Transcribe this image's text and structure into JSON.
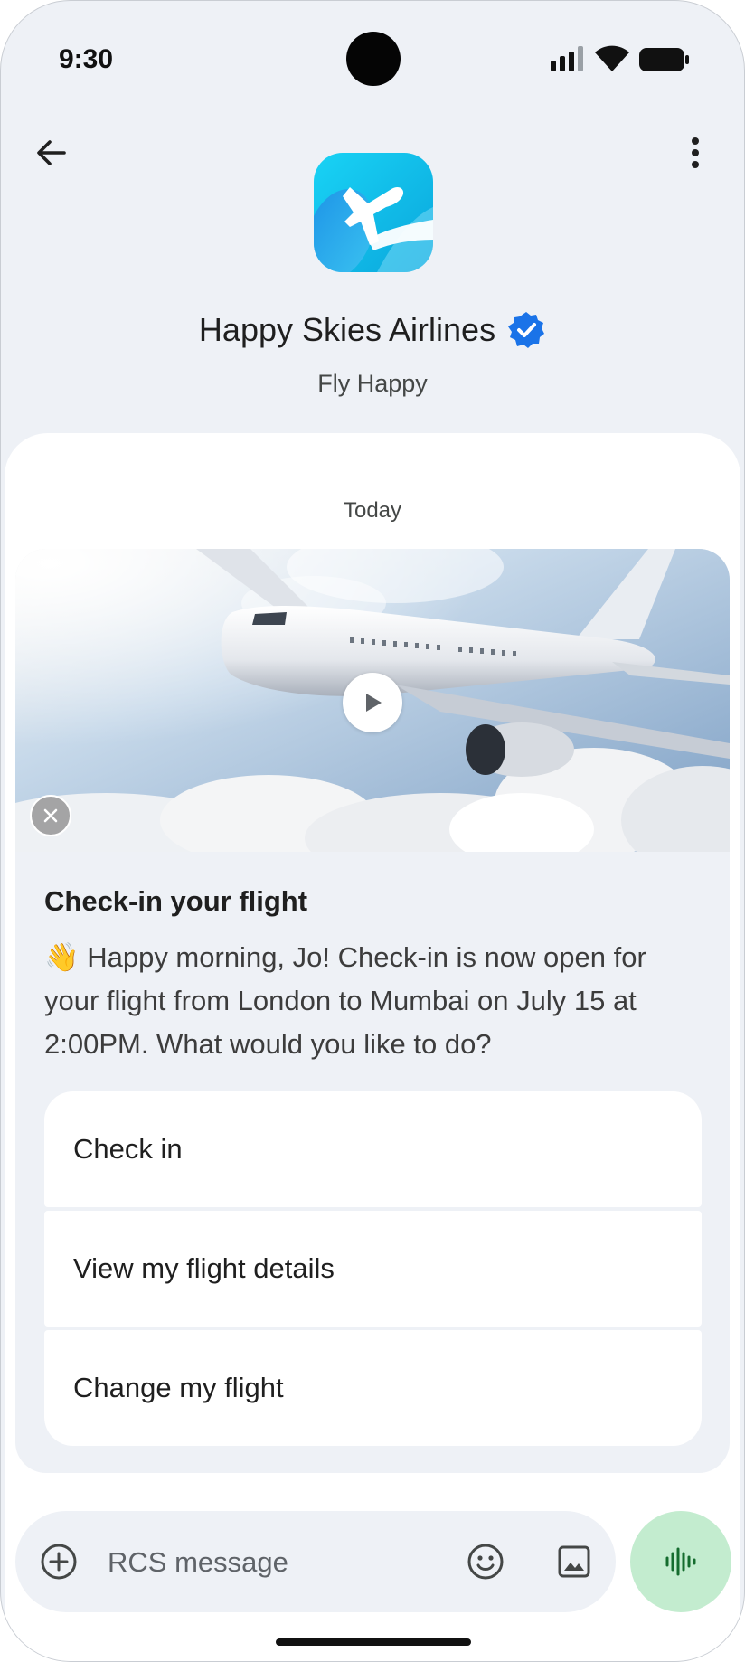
{
  "status_bar": {
    "time": "9:30",
    "icons": [
      "signal-icon",
      "wifi-icon",
      "battery-icon"
    ]
  },
  "header": {
    "back_icon": "arrow-left-icon",
    "more_icon": "more-vertical-icon",
    "logo_icon": "airplane-logo-icon",
    "brand_name": "Happy Skies Airlines",
    "verified_icon": "verified-badge-icon",
    "tagline": "Fly Happy"
  },
  "chat": {
    "date_label": "Today",
    "rich_card": {
      "media_icons": [
        "play-icon",
        "close-icon"
      ],
      "title": "Check-in your flight",
      "body": "👋 Happy morning, Jo! Check-in is now open for your flight from London to Mumbai on July 15 at 2:00PM. What would you like to do?",
      "suggestions": [
        {
          "label": "Check in"
        },
        {
          "label": "View my flight details"
        },
        {
          "label": "Change my flight"
        }
      ]
    }
  },
  "composer": {
    "placeholder": "RCS message",
    "icons": [
      "add-icon",
      "emoji-icon",
      "gallery-icon",
      "voice-waveform-icon"
    ]
  },
  "colors": {
    "background": "#eef1f6",
    "sheet": "#ffffff",
    "verified_blue": "#1a73e8",
    "logo_cyan": "#1ec8ee",
    "voice_button": "#c3eccf",
    "voice_icon": "#146c2e"
  }
}
